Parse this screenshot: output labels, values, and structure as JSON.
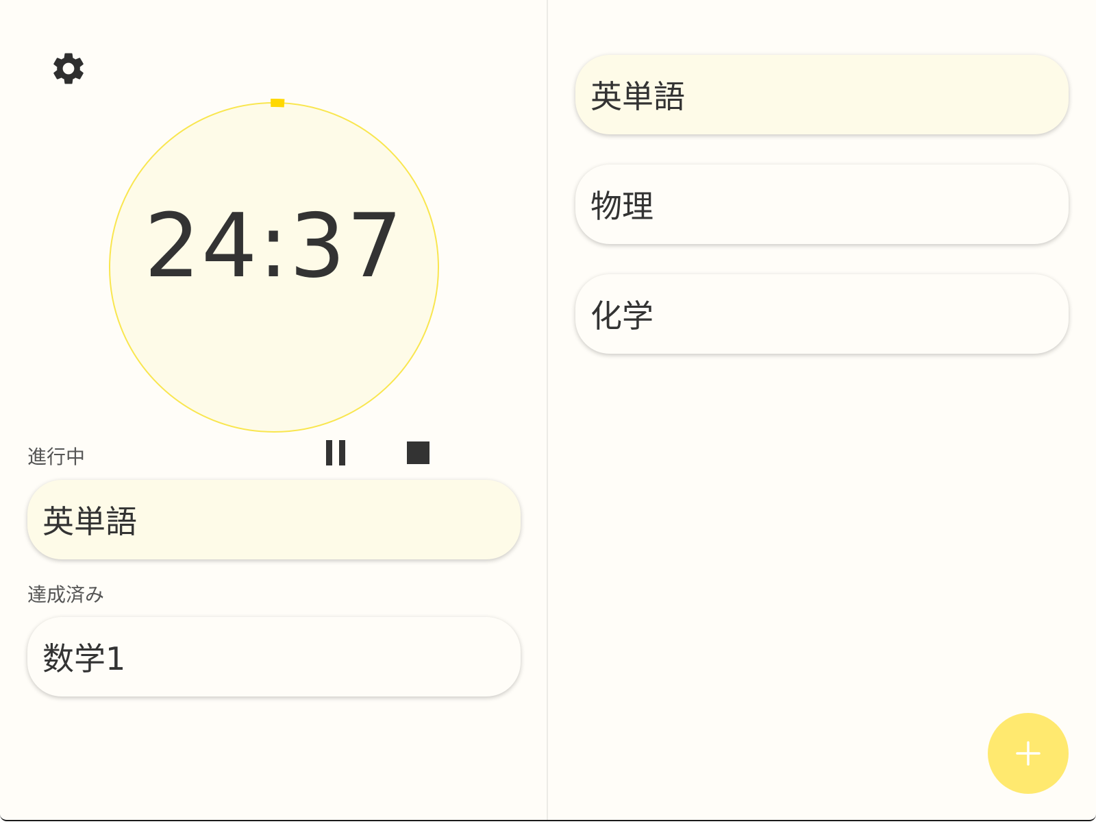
{
  "timer": {
    "display": "24:37",
    "progress_fraction": 0.01
  },
  "left_panel": {
    "in_progress_label": "進行中",
    "in_progress_item": "英単語",
    "completed_label": "達成済み",
    "completed_item": "数学1"
  },
  "subjects": [
    {
      "label": "英単語",
      "selected": true
    },
    {
      "label": "物理",
      "selected": false
    },
    {
      "label": "化学",
      "selected": false
    }
  ],
  "icons": {
    "settings": "gear-icon",
    "pause": "pause-icon",
    "stop": "stop-icon",
    "add": "plus-icon"
  },
  "colors": {
    "accent_yellow": "#ffe96f",
    "ring_yellow": "#f9e64f",
    "progress_marker": "#ffd800",
    "card_active_bg": "#fefbe8",
    "background": "#fffdf8"
  }
}
